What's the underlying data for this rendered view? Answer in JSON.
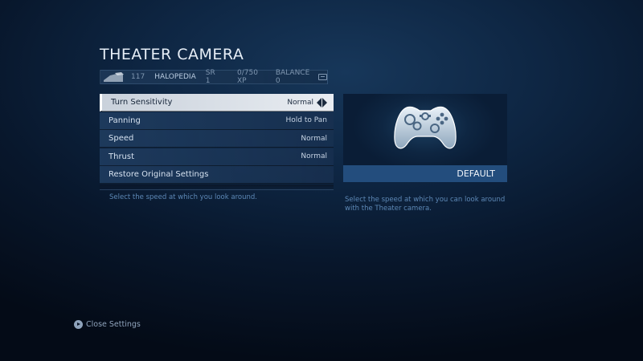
{
  "page": {
    "title": "THEATER CAMERA"
  },
  "player": {
    "level": "117",
    "gamertag": "HALOPEDIA",
    "rank": "SR 1",
    "xp": "0/750 XP",
    "balance": "BALANCE 0"
  },
  "menu": {
    "items": [
      {
        "label": "Turn Sensitivity",
        "value": "Normal",
        "selected": true
      },
      {
        "label": "Panning",
        "value": "Hold to Pan"
      },
      {
        "label": "Speed",
        "value": "Normal"
      },
      {
        "label": "Thrust",
        "value": "Normal"
      },
      {
        "label": "Restore Original Settings",
        "value": ""
      }
    ],
    "hint": "Select the speed at which you look around."
  },
  "preview": {
    "icon": "controller-icon",
    "label": "DEFAULT",
    "description": "Select the speed at which you can look around with the Theater camera."
  },
  "footer": {
    "close_label": "Close Settings",
    "icon": "play-button-icon"
  },
  "colors": {
    "accent": "#234d7d",
    "selected_bg": "#e9edf2",
    "hint_text": "#5d88b6"
  }
}
